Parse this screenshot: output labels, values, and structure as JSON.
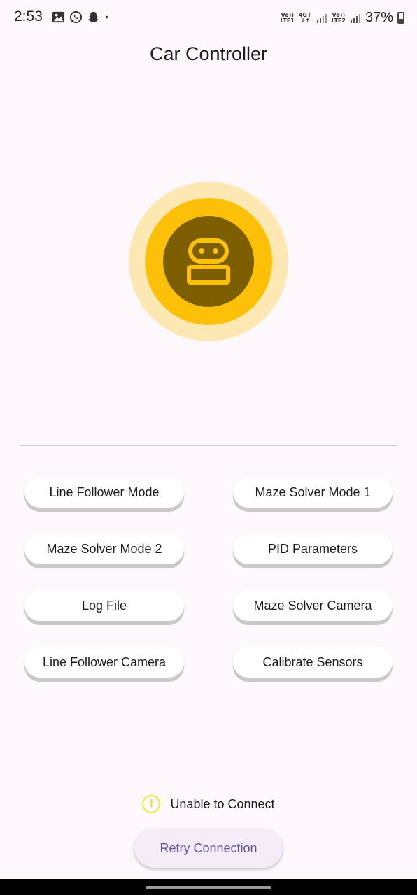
{
  "status_bar": {
    "time": "2:53",
    "sim1_label_top": "Vo))",
    "sim1_label_bottom": "LTE1",
    "network_top": "4G+",
    "network_bottom": "↓↑",
    "sim2_label_top": "Vo))",
    "sim2_label_bottom": "LTE2",
    "battery": "37%",
    "notification_icons": [
      "gallery-icon",
      "whatsapp-icon",
      "snapchat-icon",
      "dot-icon"
    ]
  },
  "app": {
    "title": "Car Controller"
  },
  "buttons": [
    {
      "label": "Line Follower Mode"
    },
    {
      "label": "Maze Solver Mode 1"
    },
    {
      "label": "Maze Solver Mode 2"
    },
    {
      "label": "PID Parameters"
    },
    {
      "label": "Log File"
    },
    {
      "label": "Maze Solver Camera"
    },
    {
      "label": "Line Follower Camera"
    },
    {
      "label": "Calibrate Sensors"
    }
  ],
  "connection": {
    "status": "Unable to Connect",
    "retry_label": "Retry Connection",
    "warning_glyph": "!"
  },
  "colors": {
    "robot_outer": "#fde8b3",
    "robot_mid": "#fdc009",
    "robot_inner": "#7d5e00",
    "robot_icon": "#fdc009",
    "warning": "#f2e72e",
    "retry_text": "#66529a"
  }
}
